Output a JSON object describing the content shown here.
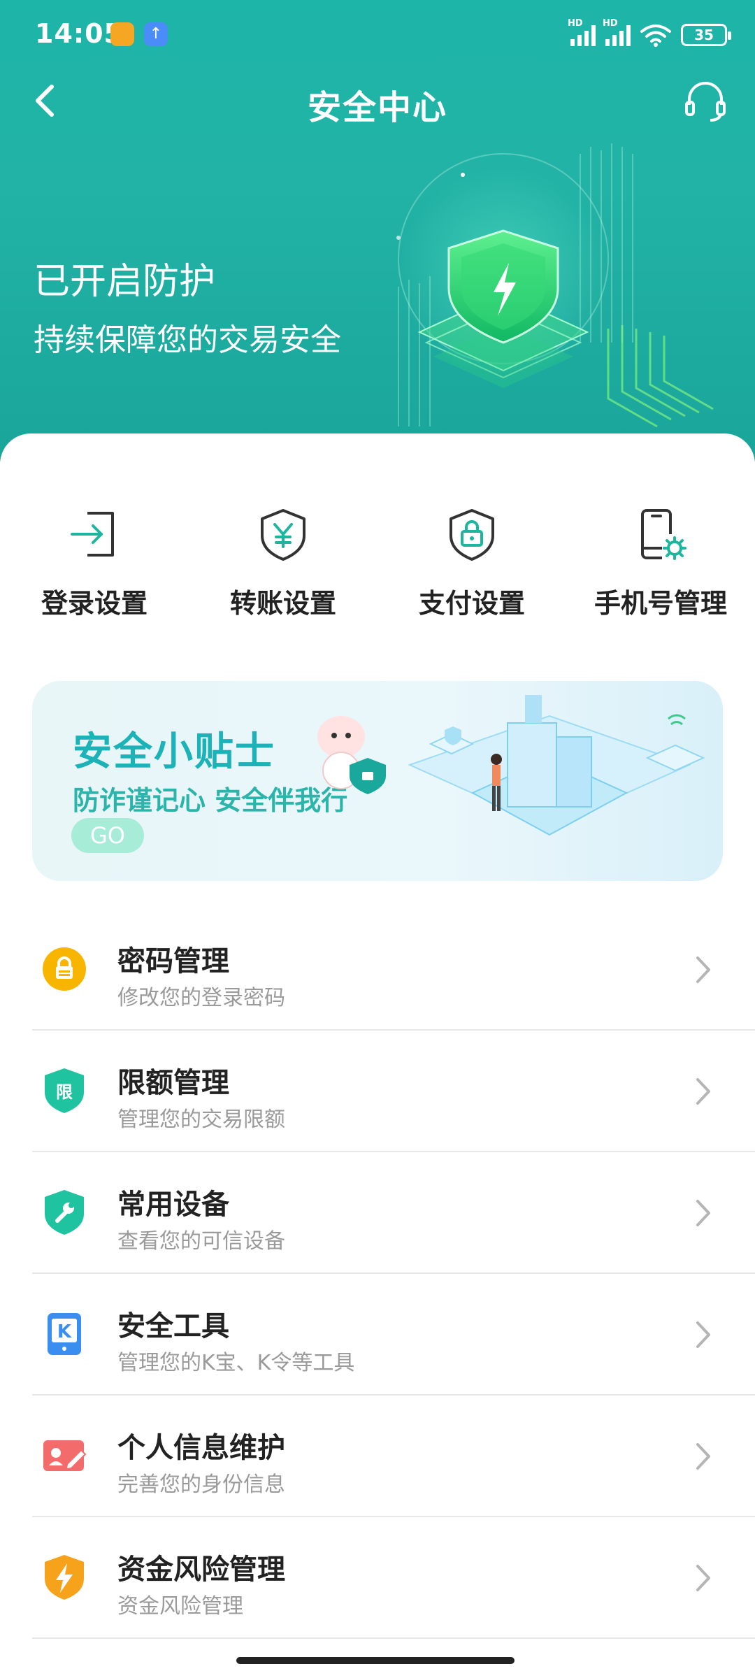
{
  "status_bar": {
    "time": "14:05",
    "battery": "35",
    "signal_label": "HD"
  },
  "nav": {
    "title": "安全中心"
  },
  "hero": {
    "title": "已开启防护",
    "subtitle": "持续保障您的交易安全"
  },
  "quick_actions": [
    {
      "label": "登录设置",
      "icon": "login-icon"
    },
    {
      "label": "转账设置",
      "icon": "yuan-shield-icon"
    },
    {
      "label": "支付设置",
      "icon": "lock-shield-icon"
    },
    {
      "label": "手机号管理",
      "icon": "phone-gear-icon"
    }
  ],
  "banner": {
    "title": "安全小贴士",
    "subtitle": "防诈谨记心 安全伴我行",
    "button": "GO"
  },
  "menu": [
    {
      "title": "密码管理",
      "subtitle": "修改您的登录密码",
      "icon": "password-lock-icon",
      "color": "#f7b500"
    },
    {
      "title": "限额管理",
      "subtitle": "管理您的交易限额",
      "icon": "limit-shield-icon",
      "color": "#1fc3a0",
      "glyph": "限"
    },
    {
      "title": "常用设备",
      "subtitle": "查看您的可信设备",
      "icon": "wrench-shield-icon",
      "color": "#1fc3a0"
    },
    {
      "title": "安全工具",
      "subtitle": "管理您的K宝、K令等工具",
      "icon": "k-token-icon",
      "color": "#3a8ef0",
      "glyph": "K"
    },
    {
      "title": "个人信息维护",
      "subtitle": "完善您的身份信息",
      "icon": "id-card-icon",
      "color": "#f46b6b"
    },
    {
      "title": "资金风险管理",
      "subtitle": "资金风险管理",
      "icon": "lightning-shield-icon",
      "color": "#f7a21b"
    }
  ],
  "colors": {
    "header": "#1db5a8",
    "accent": "#1bb3b8"
  }
}
